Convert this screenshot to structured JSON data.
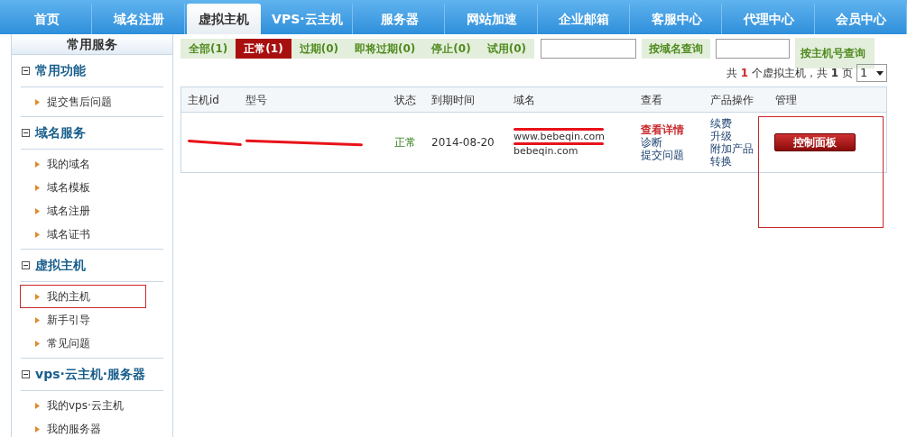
{
  "nav": [
    {
      "label": "首页",
      "selected": false
    },
    {
      "label": "域名注册",
      "selected": false
    },
    {
      "label": "虚拟主机",
      "selected": true
    },
    {
      "label": "VPS·云主机",
      "selected": false
    },
    {
      "label": "服务器",
      "selected": false
    },
    {
      "label": "网站加速",
      "selected": false
    },
    {
      "label": "企业邮箱",
      "selected": false
    },
    {
      "label": "客服中心",
      "selected": false
    },
    {
      "label": "代理中心",
      "selected": false
    },
    {
      "label": "会员中心",
      "selected": false
    }
  ],
  "sidebar": {
    "title": "常用服务",
    "groups": [
      {
        "title": "常用功能",
        "expanded": true,
        "items": [
          {
            "label": "提交售后问题",
            "highlighted": false
          }
        ]
      },
      {
        "title": "域名服务",
        "expanded": true,
        "items": [
          {
            "label": "我的域名",
            "highlighted": false
          },
          {
            "label": "域名模板",
            "highlighted": false
          },
          {
            "label": "域名注册",
            "highlighted": false
          },
          {
            "label": "域名证书",
            "highlighted": false
          }
        ]
      },
      {
        "title": "虚拟主机",
        "expanded": true,
        "items": [
          {
            "label": "我的主机",
            "highlighted": true
          },
          {
            "label": "新手引导",
            "highlighted": false
          },
          {
            "label": "常见问题",
            "highlighted": false
          }
        ]
      },
      {
        "title": "vps·云主机·服务器",
        "expanded": true,
        "items": [
          {
            "label": "我的vps·云主机",
            "highlighted": false
          },
          {
            "label": "我的服务器",
            "highlighted": false
          }
        ]
      }
    ]
  },
  "filters": [
    {
      "label": "全部(1)",
      "selected": false
    },
    {
      "label": "正常(1)",
      "selected": true
    },
    {
      "label": "过期(0)",
      "selected": false
    },
    {
      "label": "即将过期(0)",
      "selected": false
    },
    {
      "label": "停止(0)",
      "selected": false
    },
    {
      "label": "试用(0)",
      "selected": false
    }
  ],
  "search_domain": {
    "button": "按域名查询"
  },
  "search_host": {
    "button": "按主机号查询"
  },
  "summary": {
    "pre": "共",
    "count": "1",
    "mid": "个虚拟主机，共",
    "pages": "1",
    "post": "页",
    "page_select": "1"
  },
  "table": {
    "columns": [
      "主机id",
      "型号",
      "状态",
      "到期时间",
      "域名",
      "查看",
      "产品操作",
      "管理"
    ],
    "rows": [
      {
        "status": "正常",
        "expires": "2014-08-20",
        "domains": [
          "www.bebeqin.com",
          "bebeqin.com"
        ],
        "view": [
          {
            "label": "查看详情",
            "kind": "primary"
          },
          {
            "label": "诊断",
            "kind": "link"
          },
          {
            "label": "提交问题",
            "kind": "link"
          }
        ],
        "ops": [
          "续费",
          "升级",
          "附加产品",
          "转换"
        ],
        "manage": "控制面板",
        "highlighted": true
      }
    ]
  }
}
